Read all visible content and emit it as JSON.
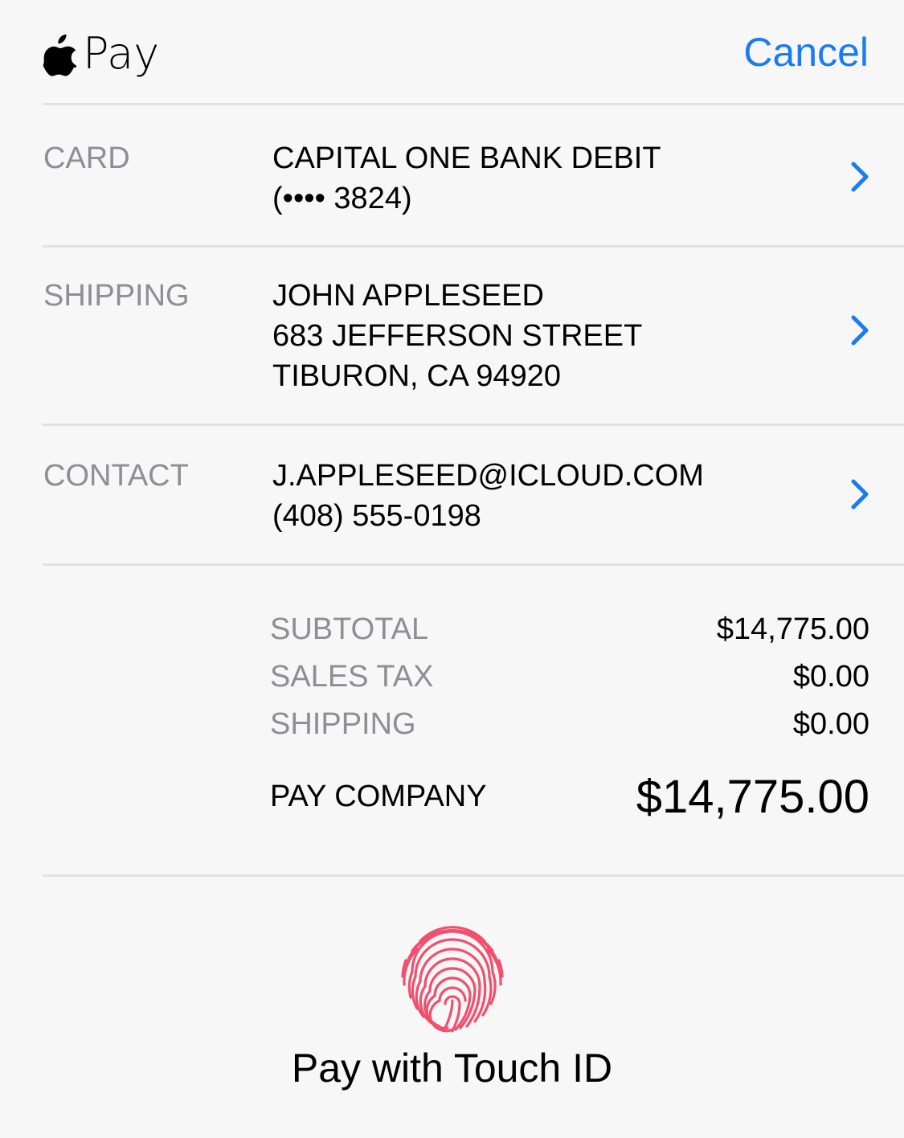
{
  "header": {
    "brand": "Pay",
    "cancel_label": "Cancel"
  },
  "card": {
    "label": "CARD",
    "lines": [
      "CAPITAL ONE BANK DEBIT",
      "(•••• 3824)"
    ]
  },
  "shipping": {
    "label": "SHIPPING",
    "lines": [
      "JOHN APPLESEED",
      "683 JEFFERSON STREET",
      "TIBURON, CA 94920"
    ]
  },
  "contact": {
    "label": "CONTACT",
    "lines": [
      "J.APPLESEED@ICLOUD.COM",
      "(408) 555-0198"
    ]
  },
  "totals": {
    "subtotal_label": "SUBTOTAL",
    "subtotal_value": "$14,775.00",
    "tax_label": "SALES TAX",
    "tax_value": "$0.00",
    "shipping_label": "SHIPPING",
    "shipping_value": "$0.00",
    "pay_label": "PAY COMPANY",
    "pay_value": "$14,775.00"
  },
  "touch_id": {
    "label": "Pay with Touch ID"
  },
  "icons": {
    "apple": "apple-logo-icon",
    "chevron": "chevron-right-icon",
    "fingerprint": "fingerprint-icon"
  },
  "colors": {
    "accent": "#1a7cf0",
    "fingerprint": "#f0506e",
    "secondary_text": "#8e8e93"
  }
}
